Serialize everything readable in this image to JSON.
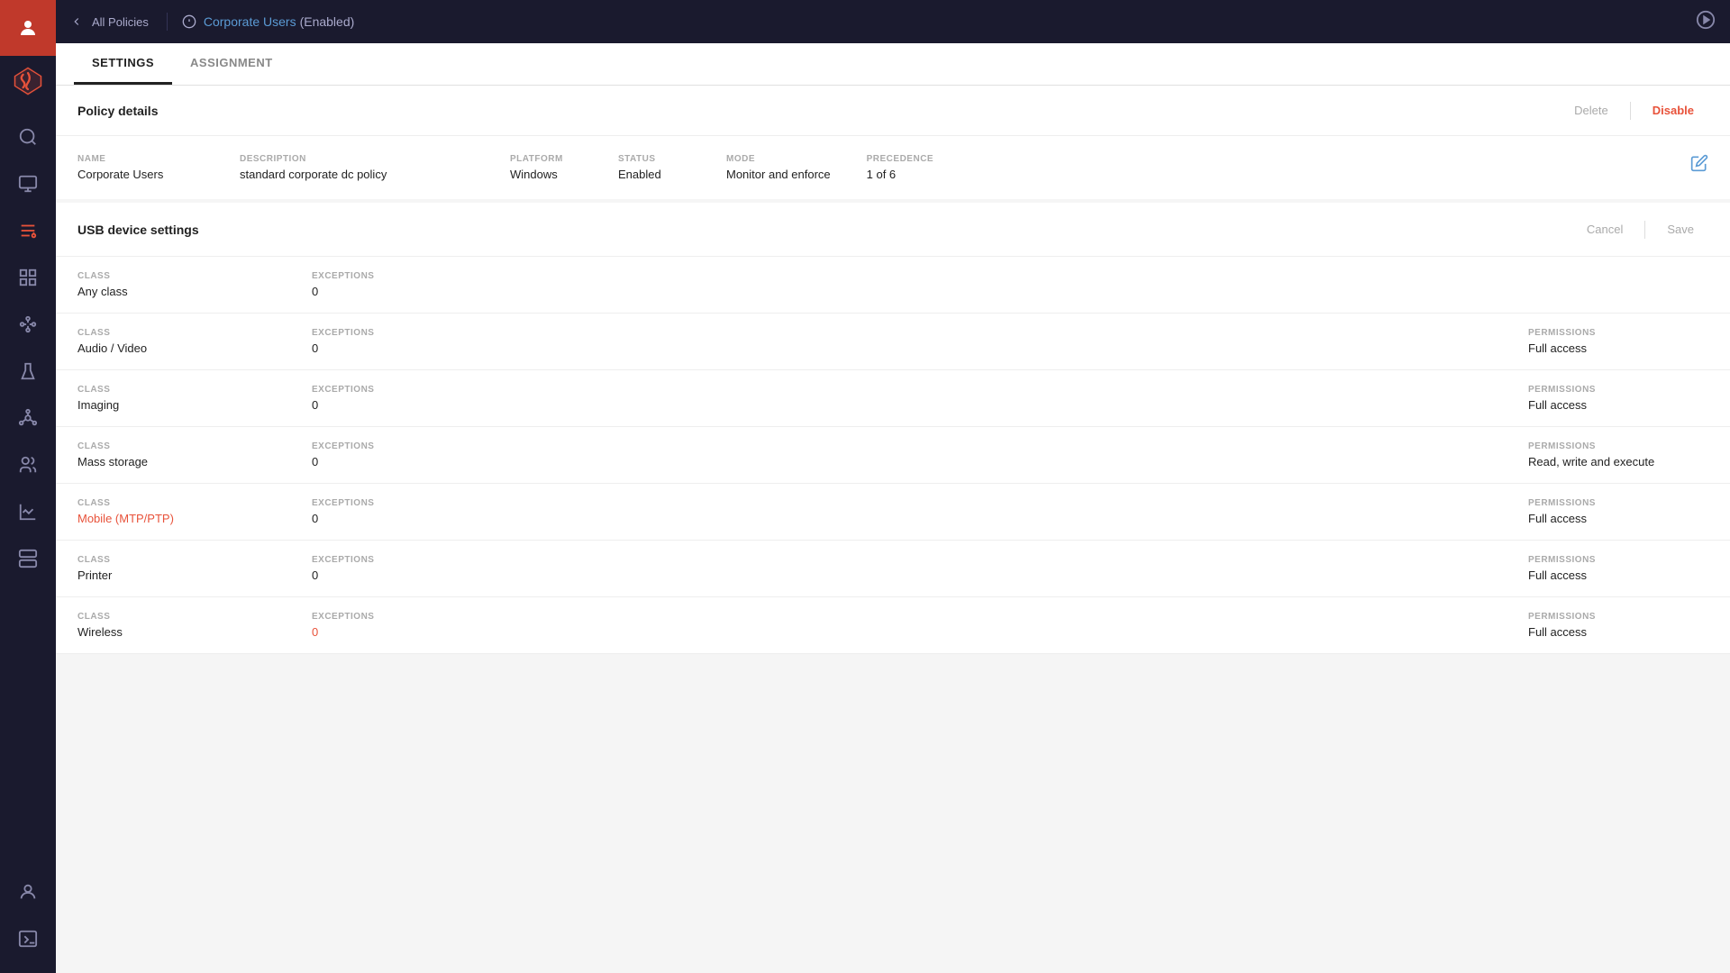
{
  "sidebar": {
    "avatar_icon": "👤",
    "items": [
      {
        "id": "search",
        "icon": "search"
      },
      {
        "id": "monitor",
        "icon": "monitor"
      },
      {
        "id": "sliders",
        "icon": "sliders",
        "active": true
      },
      {
        "id": "grid",
        "icon": "grid"
      },
      {
        "id": "graph",
        "icon": "graph"
      },
      {
        "id": "flask",
        "icon": "flask"
      },
      {
        "id": "network",
        "icon": "network"
      },
      {
        "id": "users",
        "icon": "users"
      },
      {
        "id": "graph2",
        "icon": "graph2"
      },
      {
        "id": "server",
        "icon": "server"
      }
    ],
    "bottom_items": [
      {
        "id": "user-bottom",
        "icon": "user"
      },
      {
        "id": "terminal",
        "icon": "terminal"
      }
    ]
  },
  "topbar": {
    "back_label": "All Policies",
    "policy_name": "Corporate Users",
    "policy_status": "(Enabled)",
    "play_icon": "▶"
  },
  "tabs": [
    {
      "id": "settings",
      "label": "SETTINGS",
      "active": true
    },
    {
      "id": "assignment",
      "label": "ASSIGNMENT",
      "active": false
    }
  ],
  "policy_details": {
    "section_title": "Policy details",
    "delete_label": "Delete",
    "disable_label": "Disable",
    "fields": {
      "name_label": "NAME",
      "name_value": "Corporate Users",
      "description_label": "DESCRIPTION",
      "description_value": "standard corporate dc policy",
      "platform_label": "PLATFORM",
      "platform_value": "Windows",
      "status_label": "STATUS",
      "status_value": "Enabled",
      "mode_label": "MODE",
      "mode_value": "Monitor and enforce",
      "precedence_label": "PRECEDENCE",
      "precedence_value": "1 of 6"
    }
  },
  "usb_settings": {
    "section_title": "USB device settings",
    "cancel_label": "Cancel",
    "save_label": "Save",
    "rows": [
      {
        "class_label": "CLASS",
        "class_value": "Any class",
        "class_link": false,
        "exceptions_label": "EXCEPTIONS",
        "exceptions_value": "0",
        "permissions_label": null,
        "permissions_value": null
      },
      {
        "class_label": "CLASS",
        "class_value": "Audio / Video",
        "class_link": false,
        "exceptions_label": "EXCEPTIONS",
        "exceptions_value": "0",
        "permissions_label": "PERMISSIONS",
        "permissions_value": "Full access"
      },
      {
        "class_label": "CLASS",
        "class_value": "Imaging",
        "class_link": false,
        "exceptions_label": "EXCEPTIONS",
        "exceptions_value": "0",
        "permissions_label": "PERMISSIONS",
        "permissions_value": "Full access"
      },
      {
        "class_label": "CLASS",
        "class_value": "Mass storage",
        "class_link": false,
        "exceptions_label": "EXCEPTIONS",
        "exceptions_value": "0",
        "permissions_label": "PERMISSIONS",
        "permissions_value": "Read, write and execute"
      },
      {
        "class_label": "CLASS",
        "class_value": "Mobile (MTP/PTP)",
        "class_link": true,
        "exceptions_label": "EXCEPTIONS",
        "exceptions_value": "0",
        "permissions_label": "PERMISSIONS",
        "permissions_value": "Full access"
      },
      {
        "class_label": "CLASS",
        "class_value": "Printer",
        "class_link": false,
        "exceptions_label": "EXCEPTIONS",
        "exceptions_value": "0",
        "permissions_label": "PERMISSIONS",
        "permissions_value": "Full access"
      },
      {
        "class_label": "CLASS",
        "class_value": "Wireless",
        "class_link": false,
        "exceptions_label": "EXCEPTIONS",
        "exceptions_value": "0",
        "permissions_label": "PERMISSIONS",
        "permissions_value": "Full access"
      }
    ]
  }
}
